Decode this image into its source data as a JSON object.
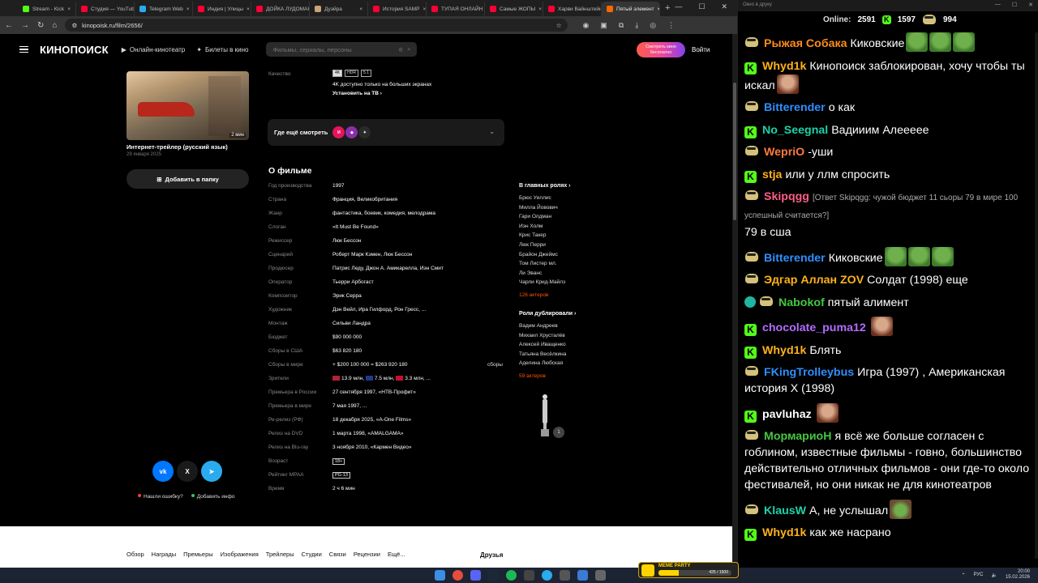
{
  "browser": {
    "tabs": [
      {
        "label": "Stream - Kick",
        "color": "#53fc18"
      },
      {
        "label": "Студия — YouTube",
        "color": "#ff0033"
      },
      {
        "label": "Telegram Web",
        "color": "#2aabee"
      },
      {
        "label": "Индия | Улицы",
        "color": "#ff0033"
      },
      {
        "label": "ДОЙКА ЛУДОМАНА",
        "color": "#ff0033"
      },
      {
        "label": "Дуэйра",
        "color": "#c9a27a"
      },
      {
        "label": "История SAMP",
        "color": "#ff0033"
      },
      {
        "label": "ТУПАЯ ОНЛАЙН",
        "color": "#ff0033"
      },
      {
        "label": "Самые ЖОПЫ",
        "color": "#ff0033"
      },
      {
        "label": "Харви Вайнштейн",
        "color": "#ff0033"
      },
      {
        "label": "Пятый элемент",
        "color": "#ff6600",
        "active": true
      }
    ],
    "url": "kinopoisk.ru/film/2656/"
  },
  "header": {
    "logo": "КИНОПОИСК",
    "nav_online": "Онлайн-кинотеатр",
    "nav_tickets": "Билеты в кино",
    "search_placeholder": "Фильмы, сериалы, персоны",
    "watch_btn": "Смотреть кино бесплатно",
    "login": "Войти"
  },
  "trailer": {
    "duration": "2 мин",
    "title": "Интернет-трейлер (русский язык)",
    "date": "29 января 2025",
    "add_folder": "Добавить в папку"
  },
  "quality": {
    "label": "Качество",
    "badges": [
      "4K",
      "HDR",
      "5.1"
    ],
    "note": "4K доступно только на больших экранах",
    "link": "Установить на ТВ"
  },
  "where_watch": {
    "label": "Где ещё смотреть"
  },
  "about": {
    "title": "О фильме",
    "facts": [
      {
        "label": "Год производства",
        "value": "1997"
      },
      {
        "label": "Страна",
        "value": "Франция, Великобритания"
      },
      {
        "label": "Жанр",
        "value": "фантастика, боевик, комедия, мелодрама"
      },
      {
        "label": "Слоган",
        "value": "«It Must Be Found»"
      },
      {
        "label": "Режиссер",
        "value": "Люк Бессон"
      },
      {
        "label": "Сценарий",
        "value": "Роберт Марк Кэмен, Люк Бессон"
      },
      {
        "label": "Продюсер",
        "value": "Патрис Леду, Джон А. Амикарелла, Иэн Смит"
      },
      {
        "label": "Оператор",
        "value": "Тьерри Арбогаст"
      },
      {
        "label": "Композитор",
        "value": "Эрик Серра"
      },
      {
        "label": "Художник",
        "value": "Дэн Вейл, Ира Гилфорд, Рон Гресс, ..."
      },
      {
        "label": "Монтаж",
        "value": "Сильви Ландра"
      },
      {
        "label": "Бюджет",
        "value": "$90 000 000"
      },
      {
        "label": "Сборы в США",
        "value": "$63 820 180"
      },
      {
        "label": "Сборы в мире",
        "value": "+ $200 100 000 = $263 920 180",
        "extra": "сборы"
      },
      {
        "label": "Зрители",
        "value": "13.9 млн, 7.5 млн, 3.3 млн, ..."
      },
      {
        "label": "Премьера в России",
        "value": "27 сентября 1997, «НТВ-Профит»"
      },
      {
        "label": "Премьера в мире",
        "value": "7 мая 1997, ..."
      },
      {
        "label": "Ре-релиз (РФ)",
        "value": "18 декабря 2025, «A-One Films»"
      },
      {
        "label": "Релиз на DVD",
        "value": "1 марта 1998, «AMALGAMA»"
      },
      {
        "label": "Релиз на Blu-ray",
        "value": "3 ноября 2010, «Кармен Видео»"
      },
      {
        "label": "Возраст",
        "value": "18+",
        "boxed": true
      },
      {
        "label": "Рейтинг MPAA",
        "value": "PG-13",
        "boxed": true
      },
      {
        "label": "Время",
        "value": "2 ч 6 мин"
      }
    ]
  },
  "cast": {
    "title": "В главных ролях",
    "actors": [
      "Брюс Уиллис",
      "Милла Йовович",
      "Гари Олдман",
      "Иэн Холм",
      "Крис Такер",
      "Люк Перри",
      "Брайон Джеймс",
      "Том Листер мл.",
      "Ли Эванс",
      "Чарли Крид-Майлз"
    ],
    "count": "126 актеров"
  },
  "dub": {
    "title": "Роли дублировали",
    "actors": [
      "Вадим Андреев",
      "Михаил Хрусталёв",
      "Алексей Иващенко",
      "Татьяна Весёлкина",
      "Аделина Любская"
    ],
    "count": "59 актеров"
  },
  "awards": {
    "count": "1"
  },
  "share": {
    "vk": "vk",
    "x": "X"
  },
  "feedback": {
    "error": "Нашли ошибку?",
    "add": "Добавить инфо"
  },
  "subnav": {
    "items": [
      "Обзор",
      "Награды",
      "Премьеры",
      "Изображения",
      "Трейлеры",
      "Студии",
      "Связи",
      "Рецензии",
      "Ещё..."
    ],
    "friends": "Друзья"
  },
  "chat": {
    "window_title": "Окно в друку",
    "online_label": "Online:",
    "online_count": "2591",
    "kick_count": "1597",
    "twitch_count": "994",
    "messages": [
      {
        "platform": "tw",
        "name": "Рыжая Собака",
        "color": "#ff8c1a",
        "text": "Киковские",
        "emotes": [
          "frog",
          "frog",
          "frog"
        ]
      },
      {
        "platform": "kick",
        "name": "Whyd1k",
        "color": "#ffb21a",
        "text": "Кинопоиск заблокирован, хочу чтобы ты искал",
        "emotes": [
          "face"
        ]
      },
      {
        "platform": "tw",
        "name": "Bitterender",
        "color": "#2f8fff",
        "text": "о как"
      },
      {
        "platform": "kick",
        "name": "No_Seegnal",
        "color": "#1bd3a9",
        "text": "Вадииим Алеееее"
      },
      {
        "platform": "tw",
        "name": "WepriO",
        "color": "#ff7a3d",
        "text": "-уши"
      },
      {
        "platform": "kick",
        "name": "stja",
        "color": "#ffb21a",
        "text": "или у ллм спросить"
      },
      {
        "platform": "tw",
        "name": "Skipqgg",
        "color": "#ff5e87",
        "reply": "[Ответ Skipqgg: чужой бюджет 11 сьоры 79 в мире 100 успешный считается?]",
        "text": "79 в сша"
      },
      {
        "platform": "tw",
        "name": "Bitterender",
        "color": "#2f8fff",
        "text": "Киковские",
        "emotes": [
          "frog",
          "frog",
          "frog"
        ]
      },
      {
        "platform": "tw",
        "name": "Эдгар Аллан ZOV",
        "color": "#ffb21a",
        "text": "Солдат (1998) еще"
      },
      {
        "platform": "tw",
        "name": "Nabokof",
        "color": "#45c742",
        "verified": true,
        "text": "пятый алимент"
      },
      {
        "platform": "kick",
        "name": "chocolate_puma12",
        "color": "#b36cff",
        "text": "",
        "emotes": [
          "face"
        ]
      },
      {
        "platform": "kick",
        "name": "Whyd1k",
        "color": "#ffb21a",
        "text": "Блять"
      },
      {
        "platform": "tw",
        "name": "FKingTrolleybus",
        "color": "#2f8fff",
        "text": "Игра (1997) , Американская история X (1998)"
      },
      {
        "platform": "kick",
        "name": "pavluhaz",
        "color": "#ffffff",
        "text": "",
        "emotes": [
          "face"
        ]
      },
      {
        "platform": "tw",
        "name": "МормариоН",
        "color": "#45c742",
        "text": "я всё же больше согласен с гоблином, известные фильмы - говно, большинство действительно отличных фильмов - они где-то около фестивалей, но они никак не для кинотеатров"
      },
      {
        "platform": "tw",
        "name": "KlausW",
        "color": "#1bd3a9",
        "text": "А, не услышал",
        "emotes": [
          "helm"
        ]
      },
      {
        "platform": "kick",
        "name": "Whyd1k",
        "color": "#ffb21a",
        "text": "как же насрано"
      }
    ]
  },
  "widget": {
    "title": "MEME PARTY",
    "progress_text": "425 / 1500",
    "progress": 0.28
  },
  "taskbar": {
    "lang": "РУС",
    "time": "20:00",
    "date": "15.02.2026"
  }
}
